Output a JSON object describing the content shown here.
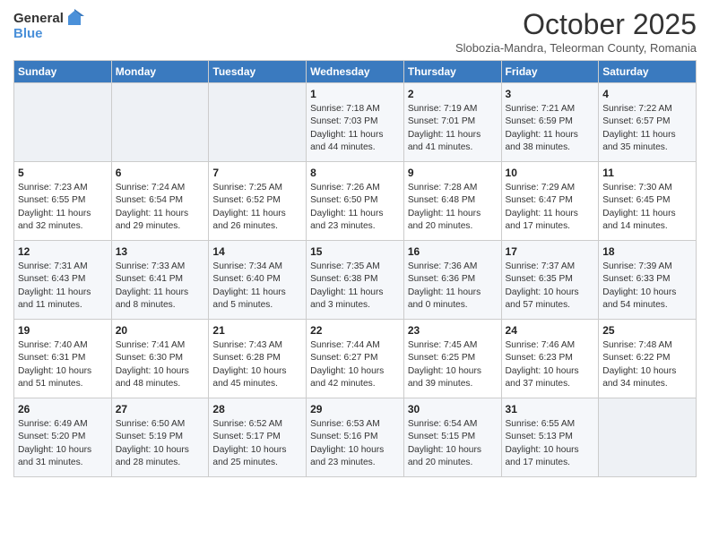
{
  "header": {
    "logo_line1": "General",
    "logo_line2": "Blue",
    "month": "October 2025",
    "location": "Slobozia-Mandra, Teleorman County, Romania"
  },
  "weekdays": [
    "Sunday",
    "Monday",
    "Tuesday",
    "Wednesday",
    "Thursday",
    "Friday",
    "Saturday"
  ],
  "weeks": [
    [
      {
        "day": "",
        "info": ""
      },
      {
        "day": "",
        "info": ""
      },
      {
        "day": "",
        "info": ""
      },
      {
        "day": "1",
        "info": "Sunrise: 7:18 AM\nSunset: 7:03 PM\nDaylight: 11 hours\nand 44 minutes."
      },
      {
        "day": "2",
        "info": "Sunrise: 7:19 AM\nSunset: 7:01 PM\nDaylight: 11 hours\nand 41 minutes."
      },
      {
        "day": "3",
        "info": "Sunrise: 7:21 AM\nSunset: 6:59 PM\nDaylight: 11 hours\nand 38 minutes."
      },
      {
        "day": "4",
        "info": "Sunrise: 7:22 AM\nSunset: 6:57 PM\nDaylight: 11 hours\nand 35 minutes."
      }
    ],
    [
      {
        "day": "5",
        "info": "Sunrise: 7:23 AM\nSunset: 6:55 PM\nDaylight: 11 hours\nand 32 minutes."
      },
      {
        "day": "6",
        "info": "Sunrise: 7:24 AM\nSunset: 6:54 PM\nDaylight: 11 hours\nand 29 minutes."
      },
      {
        "day": "7",
        "info": "Sunrise: 7:25 AM\nSunset: 6:52 PM\nDaylight: 11 hours\nand 26 minutes."
      },
      {
        "day": "8",
        "info": "Sunrise: 7:26 AM\nSunset: 6:50 PM\nDaylight: 11 hours\nand 23 minutes."
      },
      {
        "day": "9",
        "info": "Sunrise: 7:28 AM\nSunset: 6:48 PM\nDaylight: 11 hours\nand 20 minutes."
      },
      {
        "day": "10",
        "info": "Sunrise: 7:29 AM\nSunset: 6:47 PM\nDaylight: 11 hours\nand 17 minutes."
      },
      {
        "day": "11",
        "info": "Sunrise: 7:30 AM\nSunset: 6:45 PM\nDaylight: 11 hours\nand 14 minutes."
      }
    ],
    [
      {
        "day": "12",
        "info": "Sunrise: 7:31 AM\nSunset: 6:43 PM\nDaylight: 11 hours\nand 11 minutes."
      },
      {
        "day": "13",
        "info": "Sunrise: 7:33 AM\nSunset: 6:41 PM\nDaylight: 11 hours\nand 8 minutes."
      },
      {
        "day": "14",
        "info": "Sunrise: 7:34 AM\nSunset: 6:40 PM\nDaylight: 11 hours\nand 5 minutes."
      },
      {
        "day": "15",
        "info": "Sunrise: 7:35 AM\nSunset: 6:38 PM\nDaylight: 11 hours\nand 3 minutes."
      },
      {
        "day": "16",
        "info": "Sunrise: 7:36 AM\nSunset: 6:36 PM\nDaylight: 11 hours\nand 0 minutes."
      },
      {
        "day": "17",
        "info": "Sunrise: 7:37 AM\nSunset: 6:35 PM\nDaylight: 10 hours\nand 57 minutes."
      },
      {
        "day": "18",
        "info": "Sunrise: 7:39 AM\nSunset: 6:33 PM\nDaylight: 10 hours\nand 54 minutes."
      }
    ],
    [
      {
        "day": "19",
        "info": "Sunrise: 7:40 AM\nSunset: 6:31 PM\nDaylight: 10 hours\nand 51 minutes."
      },
      {
        "day": "20",
        "info": "Sunrise: 7:41 AM\nSunset: 6:30 PM\nDaylight: 10 hours\nand 48 minutes."
      },
      {
        "day": "21",
        "info": "Sunrise: 7:43 AM\nSunset: 6:28 PM\nDaylight: 10 hours\nand 45 minutes."
      },
      {
        "day": "22",
        "info": "Sunrise: 7:44 AM\nSunset: 6:27 PM\nDaylight: 10 hours\nand 42 minutes."
      },
      {
        "day": "23",
        "info": "Sunrise: 7:45 AM\nSunset: 6:25 PM\nDaylight: 10 hours\nand 39 minutes."
      },
      {
        "day": "24",
        "info": "Sunrise: 7:46 AM\nSunset: 6:23 PM\nDaylight: 10 hours\nand 37 minutes."
      },
      {
        "day": "25",
        "info": "Sunrise: 7:48 AM\nSunset: 6:22 PM\nDaylight: 10 hours\nand 34 minutes."
      }
    ],
    [
      {
        "day": "26",
        "info": "Sunrise: 6:49 AM\nSunset: 5:20 PM\nDaylight: 10 hours\nand 31 minutes."
      },
      {
        "day": "27",
        "info": "Sunrise: 6:50 AM\nSunset: 5:19 PM\nDaylight: 10 hours\nand 28 minutes."
      },
      {
        "day": "28",
        "info": "Sunrise: 6:52 AM\nSunset: 5:17 PM\nDaylight: 10 hours\nand 25 minutes."
      },
      {
        "day": "29",
        "info": "Sunrise: 6:53 AM\nSunset: 5:16 PM\nDaylight: 10 hours\nand 23 minutes."
      },
      {
        "day": "30",
        "info": "Sunrise: 6:54 AM\nSunset: 5:15 PM\nDaylight: 10 hours\nand 20 minutes."
      },
      {
        "day": "31",
        "info": "Sunrise: 6:55 AM\nSunset: 5:13 PM\nDaylight: 10 hours\nand 17 minutes."
      },
      {
        "day": "",
        "info": ""
      }
    ]
  ]
}
